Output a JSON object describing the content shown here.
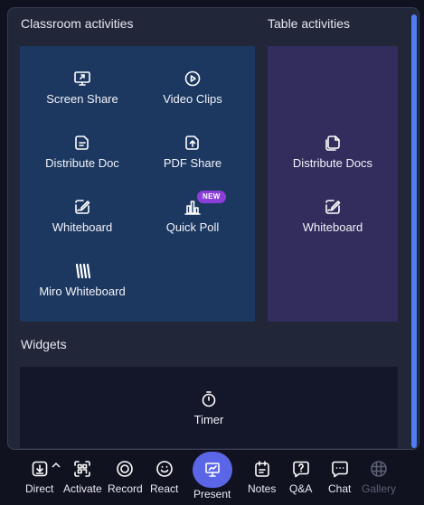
{
  "sections": {
    "classroom_title": "Classroom activities",
    "table_title": "Table activities",
    "widgets_title": "Widgets"
  },
  "classroom": {
    "screen_share": "Screen Share",
    "video_clips": "Video Clips",
    "distribute_doc": "Distribute Doc",
    "pdf_share": "PDF Share",
    "whiteboard": "Whiteboard",
    "quick_poll": "Quick Poll",
    "quick_poll_badge": "NEW",
    "miro_whiteboard": "Miro Whiteboard"
  },
  "table": {
    "distribute_docs": "Distribute Docs",
    "whiteboard": "Whiteboard"
  },
  "widgets": {
    "timer": "Timer"
  },
  "toolbar": {
    "direct": "Direct",
    "activate": "Activate",
    "record": "Record",
    "react": "React",
    "present": "Present",
    "notes": "Notes",
    "qa": "Q&A",
    "chat": "Chat",
    "gallery": "Gallery"
  },
  "colors": {
    "classroom_card": "#1c3860",
    "table_card": "#322d5c",
    "widgets_card": "#14162a",
    "accent": "#5b66e6",
    "badge": "#8a3fd8",
    "scrollbar": "#4f7df0"
  }
}
